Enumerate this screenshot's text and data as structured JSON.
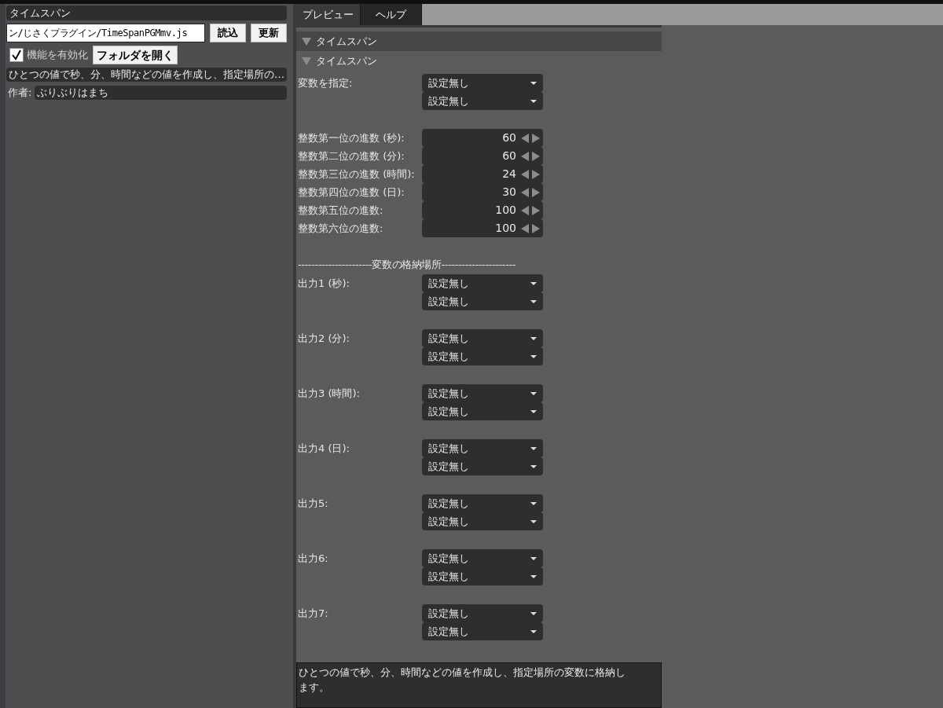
{
  "left_panel": {
    "title": "タイムスパン",
    "path_field": {
      "value": "ン/じさくプラグイン/TimeSpanPGMmv.js"
    },
    "buttons": [
      "読込",
      "更新"
    ],
    "enable": {
      "label": "機能を有効化",
      "checked": true
    },
    "open_folder_button": "フォルダを開く",
    "summary": "ひとつの値で秒、分、時間などの値を作成し、指定場所の…",
    "author": {
      "label": "作者:",
      "value": "ぶりぶりはまち"
    }
  },
  "tabs": [
    {
      "label": "プレビュー",
      "selected": true
    },
    {
      "label": "ヘルプ",
      "selected": false
    }
  ],
  "sections": [
    {
      "kind": "header",
      "title": "タイムスパン",
      "expanded": true
    },
    {
      "kind": "subheader",
      "title": "タイムスパン",
      "expanded": true
    }
  ],
  "params": [
    {
      "kind": "select",
      "label": "変数を指定:",
      "values": [
        "設定無し",
        "設定無し"
      ]
    },
    {
      "kind": "number",
      "label": "整数第一位の進数 (秒):",
      "value": "60"
    },
    {
      "kind": "number",
      "label": "整数第二位の進数 (分):",
      "value": "60"
    },
    {
      "kind": "number",
      "label": "整数第三位の進数 (時間):",
      "value": "24"
    },
    {
      "kind": "number",
      "label": "整数第四位の進数 (日):",
      "value": "30"
    },
    {
      "kind": "number",
      "label": "整数第五位の進数:",
      "value": "100"
    },
    {
      "kind": "number",
      "label": "整数第六位の進数:",
      "value": "100"
    },
    {
      "kind": "separator",
      "text": "----------------------変数の格納場所----------------------"
    },
    {
      "kind": "select",
      "label": "出力1 (秒):",
      "values": [
        "設定無し",
        "設定無し"
      ]
    },
    {
      "kind": "select",
      "label": "出力2 (分):",
      "values": [
        "設定無し",
        "設定無し"
      ]
    },
    {
      "kind": "select",
      "label": "出力3 (時間):",
      "values": [
        "設定無し",
        "設定無し"
      ]
    },
    {
      "kind": "select",
      "label": "出力4 (日):",
      "values": [
        "設定無し",
        "設定無し"
      ]
    },
    {
      "kind": "select",
      "label": "出力5:",
      "values": [
        "設定無し",
        "設定無し"
      ]
    },
    {
      "kind": "select",
      "label": "出力6:",
      "values": [
        "設定無し",
        "設定無し"
      ]
    },
    {
      "kind": "select",
      "label": "出力7:",
      "values": [
        "設定無し",
        "設定無し"
      ]
    }
  ],
  "description": "ひとつの値で秒、分、時間などの値を作成し、指定場所の変数に格納します。"
}
